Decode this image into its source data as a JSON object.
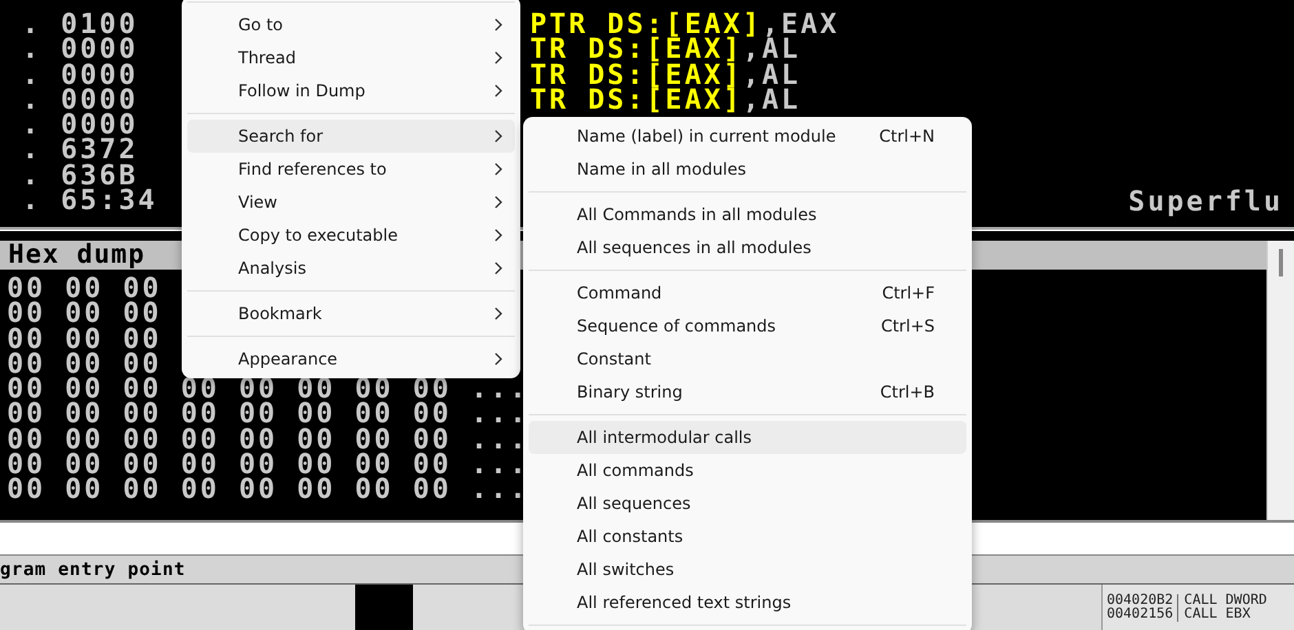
{
  "disassembly": {
    "dump_column": [
      ". 0100",
      ". 0000",
      ". 0000",
      ". 0000",
      ". 0000",
      ". 6372",
      ". 636B",
      ". 65:34"
    ],
    "commands": [
      {
        "operand": "PTR DS:[EAX]",
        "rest": ",EAX"
      },
      {
        "operand": "TR DS:[EAX]",
        "rest": ",AL"
      },
      {
        "operand": "TR DS:[EAX]",
        "rest": ",AL"
      },
      {
        "operand": "TR DS:[EAX]",
        "rest": ",AL"
      }
    ],
    "comment": "Superflu"
  },
  "hex_dump": {
    "title": "Hex dump",
    "rows": [
      "00 00 00",
      "00 00 00",
      "00 00 00",
      "00 00 00",
      "00 00 00 00 00 00 00 00 ...",
      "00 00 00 00 00 00 00 00 ...",
      "00 00 00 00 00 00 00 00 ...",
      "00 00 00 00 00 00 00 00 ...",
      "00 00 00 00 00 00 00 00 ..."
    ]
  },
  "status_bar": "gram entry point",
  "call_list": [
    {
      "address": "004020B2",
      "command": "CALL DWORD"
    },
    {
      "address": "00402156",
      "command": "CALL EBX"
    }
  ],
  "context_menu": {
    "items": [
      {
        "kind": "separator"
      },
      {
        "kind": "item",
        "label": "Go to",
        "selected": false
      },
      {
        "kind": "item",
        "label": "Thread",
        "selected": false
      },
      {
        "kind": "item",
        "label": "Follow in Dump",
        "selected": false
      },
      {
        "kind": "separator"
      },
      {
        "kind": "item",
        "label": "Search for",
        "selected": true
      },
      {
        "kind": "item",
        "label": "Find references to",
        "selected": false
      },
      {
        "kind": "item",
        "label": "View",
        "selected": false
      },
      {
        "kind": "item",
        "label": "Copy to executable",
        "selected": false
      },
      {
        "kind": "item",
        "label": "Analysis",
        "selected": false
      },
      {
        "kind": "separator"
      },
      {
        "kind": "item",
        "label": "Bookmark",
        "selected": false
      },
      {
        "kind": "separator"
      },
      {
        "kind": "item",
        "label": "Appearance",
        "selected": false
      }
    ]
  },
  "submenu": {
    "items": [
      {
        "kind": "item",
        "label": "Name (label) in current module",
        "shortcut": "Ctrl+N",
        "selected": false
      },
      {
        "kind": "item",
        "label": "Name in all modules",
        "selected": false
      },
      {
        "kind": "separator"
      },
      {
        "kind": "item",
        "label": "All Commands in all modules",
        "selected": false
      },
      {
        "kind": "item",
        "label": "All sequences in all modules",
        "selected": false
      },
      {
        "kind": "separator"
      },
      {
        "kind": "item",
        "label": "Command",
        "shortcut": "Ctrl+F",
        "selected": false
      },
      {
        "kind": "item",
        "label": "Sequence of commands",
        "shortcut": "Ctrl+S",
        "selected": false
      },
      {
        "kind": "item",
        "label": "Constant",
        "selected": false
      },
      {
        "kind": "item",
        "label": "Binary string",
        "shortcut": "Ctrl+B",
        "selected": false
      },
      {
        "kind": "separator"
      },
      {
        "kind": "item",
        "label": "All intermodular calls",
        "selected": true
      },
      {
        "kind": "item",
        "label": "All commands",
        "selected": false
      },
      {
        "kind": "item",
        "label": "All sequences",
        "selected": false
      },
      {
        "kind": "item",
        "label": "All constants",
        "selected": false
      },
      {
        "kind": "item",
        "label": "All switches",
        "selected": false
      },
      {
        "kind": "item",
        "label": "All referenced text strings",
        "selected": false
      },
      {
        "kind": "separator"
      }
    ]
  }
}
